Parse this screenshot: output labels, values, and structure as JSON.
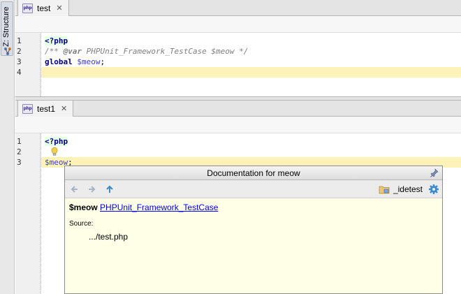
{
  "side_panel": {
    "label": "Z: Structure"
  },
  "top_editor": {
    "tab": {
      "label": "test",
      "close": "✕"
    },
    "line_numbers": [
      "1",
      "2",
      "3",
      "4"
    ],
    "lines": [
      {
        "php_tag": "<?php"
      },
      {
        "comment_open": "/** ",
        "tag": "@var",
        "comment_rest": " PHPUnit_Framework_TestCase $meow */"
      },
      {
        "keyword": "global",
        "space": " ",
        "variable": "$meow",
        "punct": ";"
      },
      {
        "text": ""
      }
    ]
  },
  "bottom_editor": {
    "tab": {
      "label": "test1",
      "close": "✕"
    },
    "line_numbers": [
      "1",
      "2",
      "3"
    ],
    "lines": [
      {
        "php_tag": "<?php"
      },
      {
        "text": ""
      },
      {
        "variable": "$meow",
        "punct": ";"
      }
    ]
  },
  "doc_popup": {
    "title": "Documentation for meow",
    "toolbar": {
      "scope_label": "_idetest"
    },
    "variable": "$meow",
    "type_link": "PHPUnit_Framework_TestCase",
    "source_label": "Source:",
    "source_path": ".../test.php"
  },
  "colors": {
    "caret_line": "#fdf3b8",
    "php_tag_bg": "#e4ffe4",
    "popup_bg": "#fffee6",
    "link": "#0000ee"
  }
}
